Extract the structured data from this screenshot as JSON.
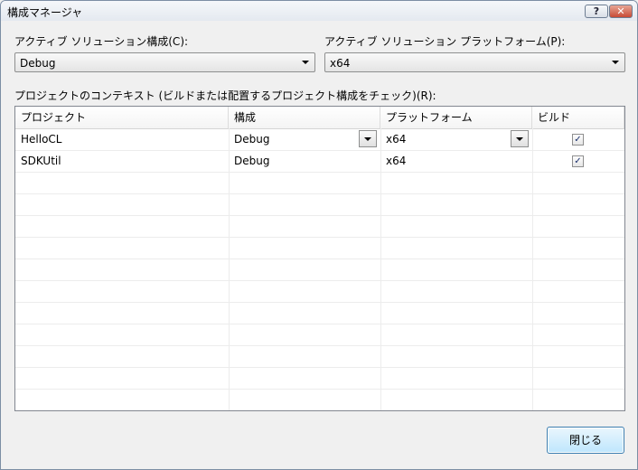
{
  "window": {
    "title": "構成マネージャ",
    "help_label": "?",
    "close_label": "✕"
  },
  "active_config": {
    "label": "アクティブ ソリューション構成(C):",
    "value": "Debug"
  },
  "active_platform": {
    "label": "アクティブ ソリューション プラットフォーム(P):",
    "value": "x64"
  },
  "context_label": "プロジェクトのコンテキスト (ビルドまたは配置するプロジェクト構成をチェック)(R):",
  "grid": {
    "headers": [
      "プロジェクト",
      "構成",
      "プラットフォーム",
      "ビルド"
    ],
    "rows": [
      {
        "project": "HelloCL",
        "config": "Debug",
        "platform": "x64",
        "build": true
      },
      {
        "project": "SDKUtil",
        "config": "Debug",
        "platform": "x64",
        "build": true
      }
    ]
  },
  "close_button": "閉じる"
}
